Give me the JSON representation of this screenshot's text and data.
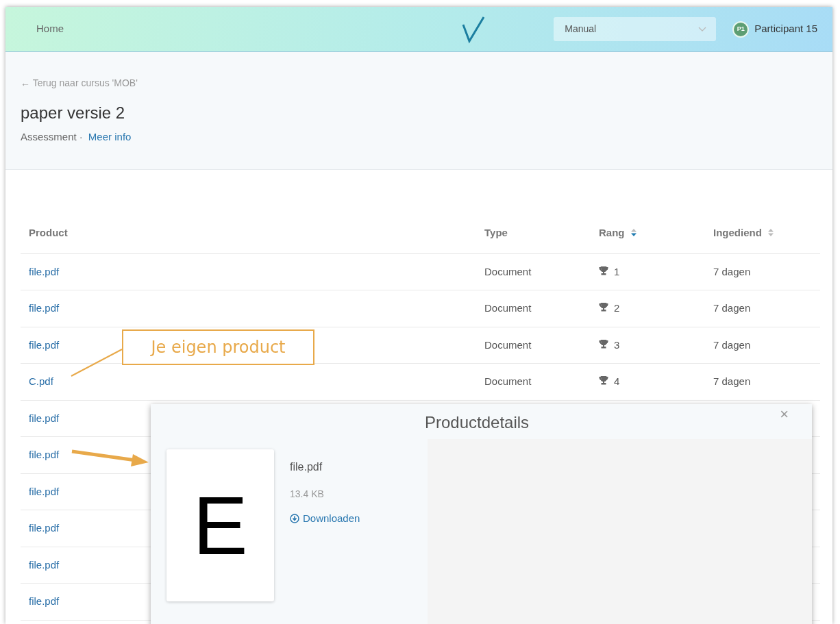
{
  "navbar": {
    "home": "Home",
    "select": {
      "value": "Manual"
    },
    "user": {
      "initials": "P1",
      "name": "Participant 15"
    }
  },
  "header": {
    "back": "← Terug naar cursus 'MOB'",
    "title": "paper versie 2",
    "meta": "Assessment ·",
    "more": "Meer info"
  },
  "table": {
    "columns": [
      {
        "label": "Product"
      },
      {
        "label": "Type"
      },
      {
        "label": "Rang",
        "sortable": true,
        "sorted": true
      },
      {
        "label": "Ingediend",
        "sortable": true,
        "sorted": false
      }
    ],
    "rows": [
      {
        "product": "file.pdf",
        "type": "Document",
        "rank": "1",
        "submitted": "7 dagen"
      },
      {
        "product": "file.pdf",
        "type": "Document",
        "rank": "2",
        "submitted": "7 dagen"
      },
      {
        "product": "file.pdf",
        "type": "Document",
        "rank": "3",
        "submitted": "7 dagen"
      },
      {
        "product": "C.pdf",
        "type": "Document",
        "rank": "4",
        "submitted": "7 dagen"
      },
      {
        "product": "file.pdf"
      },
      {
        "product": "file.pdf"
      },
      {
        "product": "file.pdf"
      },
      {
        "product": "file.pdf"
      },
      {
        "product": "file.pdf"
      },
      {
        "product": "file.pdf"
      }
    ]
  },
  "modal": {
    "title": "Productdetails",
    "close": "×",
    "preview_text": "E",
    "file_name": "file.pdf",
    "size": "13.4 KB",
    "download": "Downloaden"
  },
  "annotations": [
    {
      "kind": "callout",
      "text": "Je eigen product"
    },
    {
      "kind": "arrow"
    }
  ]
}
